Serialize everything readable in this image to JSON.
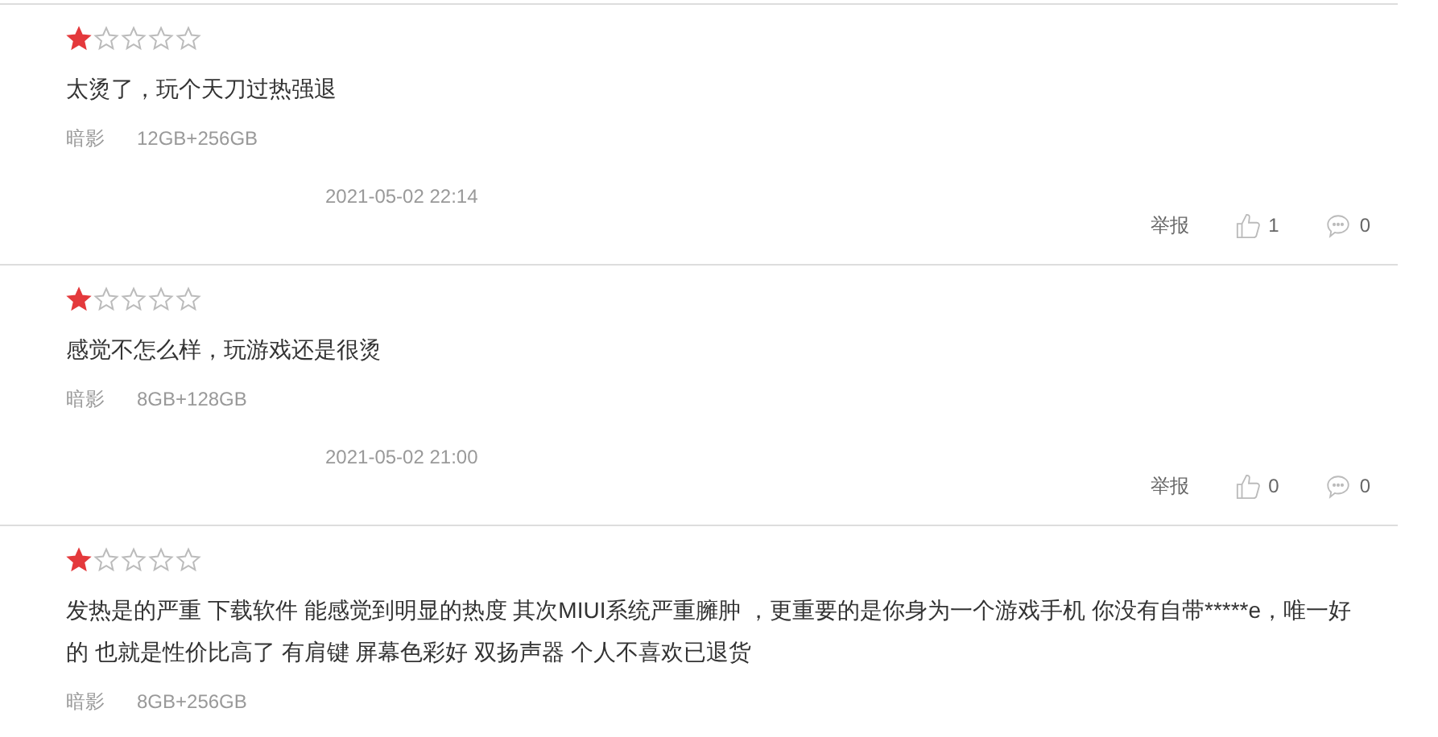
{
  "reviews": [
    {
      "stars": 1,
      "text": "太烫了，玩个天刀过热强退",
      "color_name": "暗影",
      "spec": "12GB+256GB",
      "date": "2021-05-02 22:14",
      "report": "举报",
      "likes": "1",
      "comments": "0"
    },
    {
      "stars": 1,
      "text": "感觉不怎么样，玩游戏还是很烫",
      "color_name": "暗影",
      "spec": "8GB+128GB",
      "date": "2021-05-02 21:00",
      "report": "举报",
      "likes": "0",
      "comments": "0"
    },
    {
      "stars": 1,
      "text": "发热是的严重 下载软件 能感觉到明显的热度 其次MIUI系统严重臃肿 ，更重要的是你身为一个游戏手机 你没有自带*****e，唯一好的 也就是性价比高了 有肩键 屏幕色彩好 双扬声器 个人不喜欢已退货",
      "color_name": "暗影",
      "spec": "8GB+256GB"
    }
  ]
}
